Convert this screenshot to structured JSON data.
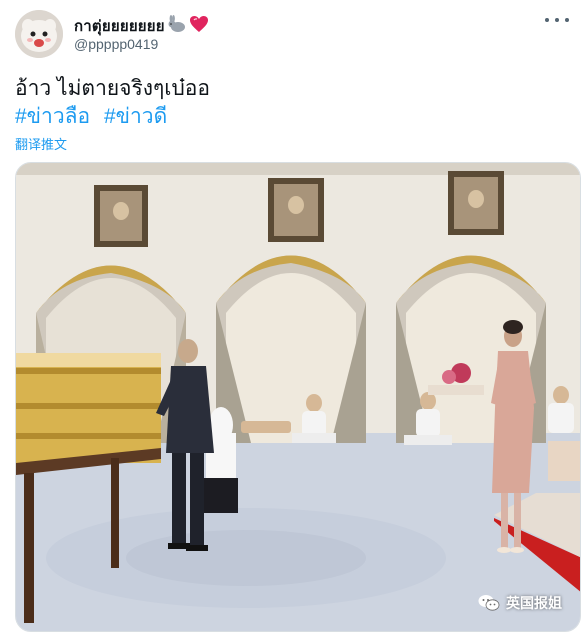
{
  "tweet": {
    "display_name": "กาตุ่ยยยยยยย",
    "name_emojis": [
      "rabbit-emoji",
      "heart-emoji"
    ],
    "handle": "@ppppp0419",
    "text": "อ้าว ไม่ตายจริงๆเบ๋ออ",
    "hashtags": [
      "#ข่าวลือ",
      "#ข่าวดี"
    ],
    "translate_label": "翻译推文"
  },
  "media": {
    "description_kind": "photo",
    "watermark_text": "英国报姐",
    "watermark_icon": "wechat-icon"
  },
  "icons": {
    "more": "more-options-icon"
  },
  "colors": {
    "link": "#1d9bf0",
    "secondary_text": "#536471",
    "carpet_red": "#c91f1f"
  }
}
